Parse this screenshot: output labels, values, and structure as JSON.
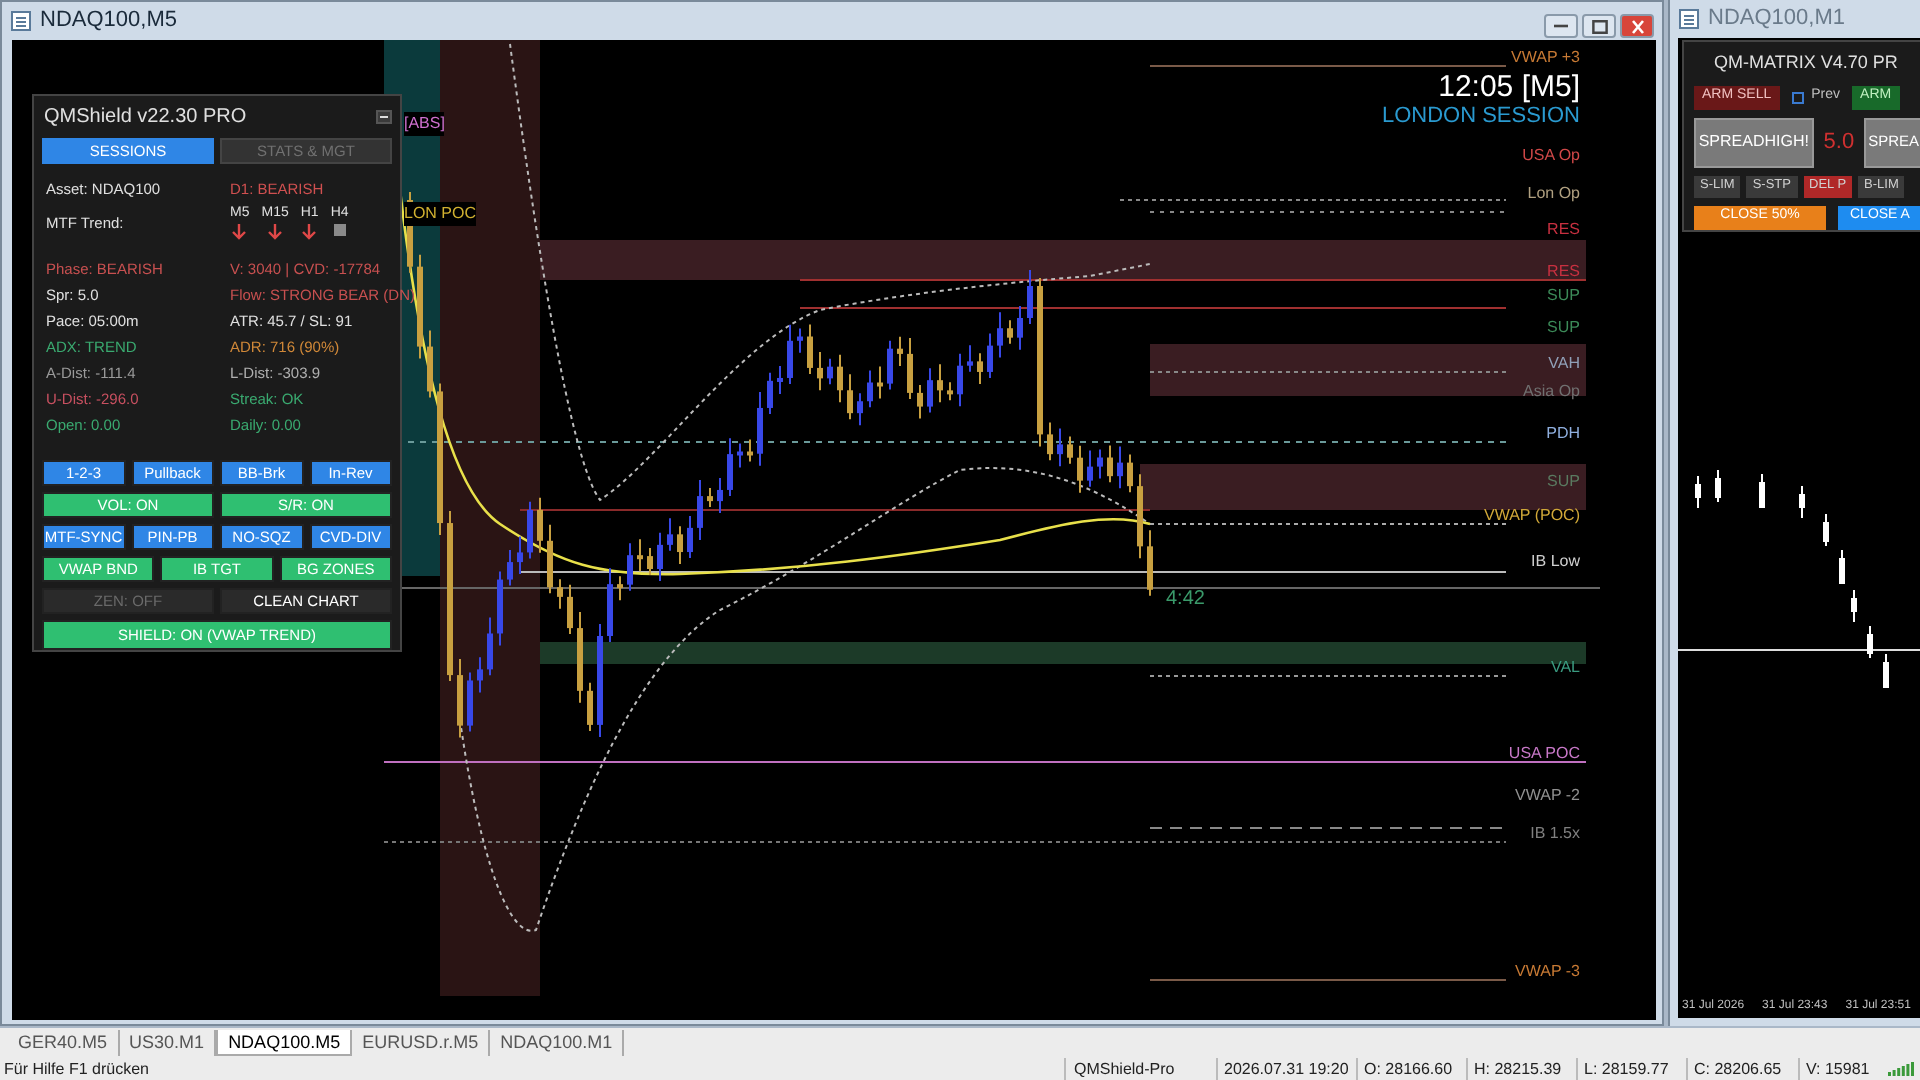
{
  "main_window": {
    "title": "NDAQ100,M5"
  },
  "chart": {
    "clock": "12:05 [M5]",
    "session": "LONDON SESSION",
    "countdown": "4:42",
    "zone_labels": [
      "[ABS]",
      "LON POC"
    ],
    "levels": [
      {
        "label": "VWAP +3",
        "color": "#c87a34"
      },
      {
        "label": "USA Op",
        "color": "#d04848"
      },
      {
        "label": "Lon Op",
        "color": "#b0a080"
      },
      {
        "label": "RES",
        "color": "#c83040"
      },
      {
        "label": "RES",
        "color": "#c83040"
      },
      {
        "label": "SUP",
        "color": "#3c8a58"
      },
      {
        "label": "SUP",
        "color": "#3c8a58"
      },
      {
        "label": "VAH",
        "color": "#90a0b8"
      },
      {
        "label": "Asia Op",
        "color": "#707070"
      },
      {
        "label": "PDH",
        "color": "#90b0e0"
      },
      {
        "label": "SUP",
        "color": "#5a7a60"
      },
      {
        "label": "VWAP (POC)",
        "color": "#d0a838"
      },
      {
        "label": "IB Low",
        "color": "#d0d0d0"
      },
      {
        "label": "VAL",
        "color": "#3a9a80"
      },
      {
        "label": "USA POC",
        "color": "#c878c8"
      },
      {
        "label": "VWAP -2",
        "color": "#909090"
      },
      {
        "label": "IB 1.5x",
        "color": "#808080"
      },
      {
        "label": "VWAP -3",
        "color": "#c87a34"
      }
    ]
  },
  "panel": {
    "title": "QMShield v22.30 PRO",
    "tabs": [
      {
        "label": "SESSIONS",
        "selected": true
      },
      {
        "label": "STATS & MGT",
        "selected": false
      }
    ],
    "header_stats": [
      {
        "text": "Asset: NDAQ100",
        "color": "#e0e0e0"
      },
      {
        "text": "D1: BEARISH",
        "color": "#d05050"
      }
    ],
    "mtf_label": "MTF Trend:",
    "timeframes": [
      {
        "label": "M5",
        "kind": "down"
      },
      {
        "label": "M15",
        "kind": "down"
      },
      {
        "label": "H1",
        "kind": "down"
      },
      {
        "label": "H4",
        "kind": "neutral"
      }
    ],
    "stats": [
      {
        "text": "Phase: BEARISH",
        "color": "#c85050"
      },
      {
        "text": "V: 3040 | CVD: -17784",
        "color": "#c85050"
      },
      {
        "text": "Spr: 5.0",
        "color": "#e0e0e0"
      },
      {
        "text": "Flow: STRONG BEAR (DN)",
        "color": "#c85050"
      },
      {
        "text": "Pace: 05:00m",
        "color": "#e0e0e0"
      },
      {
        "text": "ATR: 45.7 / SL: 91",
        "color": "#e0e0e0"
      },
      {
        "text": "ADX: TREND",
        "color": "#3aaa70"
      },
      {
        "text": "ADR: 716 (90%)",
        "color": "#d08838"
      },
      {
        "text": "A-Dist: -111.4",
        "color": "#9a9a9a"
      },
      {
        "text": "L-Dist: -303.9",
        "color": "#b0b0b0"
      },
      {
        "text": "U-Dist: -296.0",
        "color": "#c85060"
      },
      {
        "text": "Streak: OK",
        "color": "#3aaa70"
      },
      {
        "text": "Open: 0.00",
        "color": "#3aaa70"
      },
      {
        "text": "Daily: 0.00",
        "color": "#3aaa70"
      }
    ],
    "button_rows": [
      [
        {
          "label": "1-2-3",
          "color": "#2f86e6",
          "disabled": false
        },
        {
          "label": "Pullback",
          "color": "#2f86e6",
          "disabled": false
        },
        {
          "label": "BB-Brk",
          "color": "#2f86e6",
          "disabled": false
        },
        {
          "label": "In-Rev",
          "color": "#2f86e6",
          "disabled": false
        }
      ],
      [
        {
          "label": "VOL: ON",
          "color": "#2fbf71",
          "disabled": false
        },
        {
          "label": "S/R: ON",
          "color": "#2fbf71",
          "disabled": false
        }
      ],
      [
        {
          "label": "MTF-SYNC",
          "color": "#2f86e6",
          "disabled": false
        },
        {
          "label": "PIN-PB",
          "color": "#2f86e6",
          "disabled": false
        },
        {
          "label": "NO-SQZ",
          "color": "#2f86e6",
          "disabled": false
        },
        {
          "label": "CVD-DIV",
          "color": "#2f86e6",
          "disabled": false
        }
      ],
      [
        {
          "label": "VWAP BND",
          "color": "#2fbf71",
          "disabled": false
        },
        {
          "label": "IB TGT",
          "color": "#2fbf71",
          "disabled": false
        },
        {
          "label": "BG ZONES",
          "color": "#2fbf71",
          "disabled": false
        }
      ],
      [
        {
          "label": "ZEN: OFF",
          "color": "#2a2a2a",
          "disabled": true
        },
        {
          "label": "CLEAN CHART",
          "color": "#2a2a2a",
          "disabled": false
        }
      ],
      [
        {
          "label": "SHIELD: ON (VWAP TREND)",
          "color": "#2fbf71",
          "disabled": false
        }
      ]
    ]
  },
  "matrix_window": {
    "title": "NDAQ100,M1",
    "panel": {
      "title": "QM-MATRIX V4.70 PR",
      "arm_sell": "ARM SELL",
      "prev": {
        "label": "Prev",
        "checked": false
      },
      "arm_buy": "ARM",
      "spread_left": "SPREADHIGH!",
      "spread": "5.0",
      "spread_right": "SPREA",
      "order_buttons": [
        {
          "label": "S-LIM",
          "color": "#3a3a3a"
        },
        {
          "label": "S-STP",
          "color": "#3a3a3a"
        },
        {
          "label": "DEL P",
          "color": "#b02828"
        },
        {
          "label": "B-LIM",
          "color": "#3a3a3a"
        }
      ],
      "close_buttons": [
        {
          "label": "CLOSE 50%",
          "color": "#e8801a"
        },
        {
          "label": "CLOSE A",
          "color": "#1e8cf0"
        }
      ]
    },
    "time_labels": [
      "31 Jul 2026",
      "31 Jul 23:43",
      "31 Jul 23:51"
    ]
  },
  "tabs": [
    {
      "label": "GER40.M5",
      "selected": false
    },
    {
      "label": "US30.M1",
      "selected": false
    },
    {
      "label": "NDAQ100.M5",
      "selected": true
    },
    {
      "label": "EURUSD.r.M5",
      "selected": false
    },
    {
      "label": "NDAQ100.M1",
      "selected": false
    }
  ],
  "status_bar": {
    "help": "Für Hilfe F1 drücken",
    "profile": "QMShield-Pro",
    "time": "2026.07.31 19:20",
    "open": "O: 28166.60",
    "high": "H: 28215.39",
    "low": "L: 28159.77",
    "close": "C: 28206.65",
    "volume": "V: 15981"
  }
}
